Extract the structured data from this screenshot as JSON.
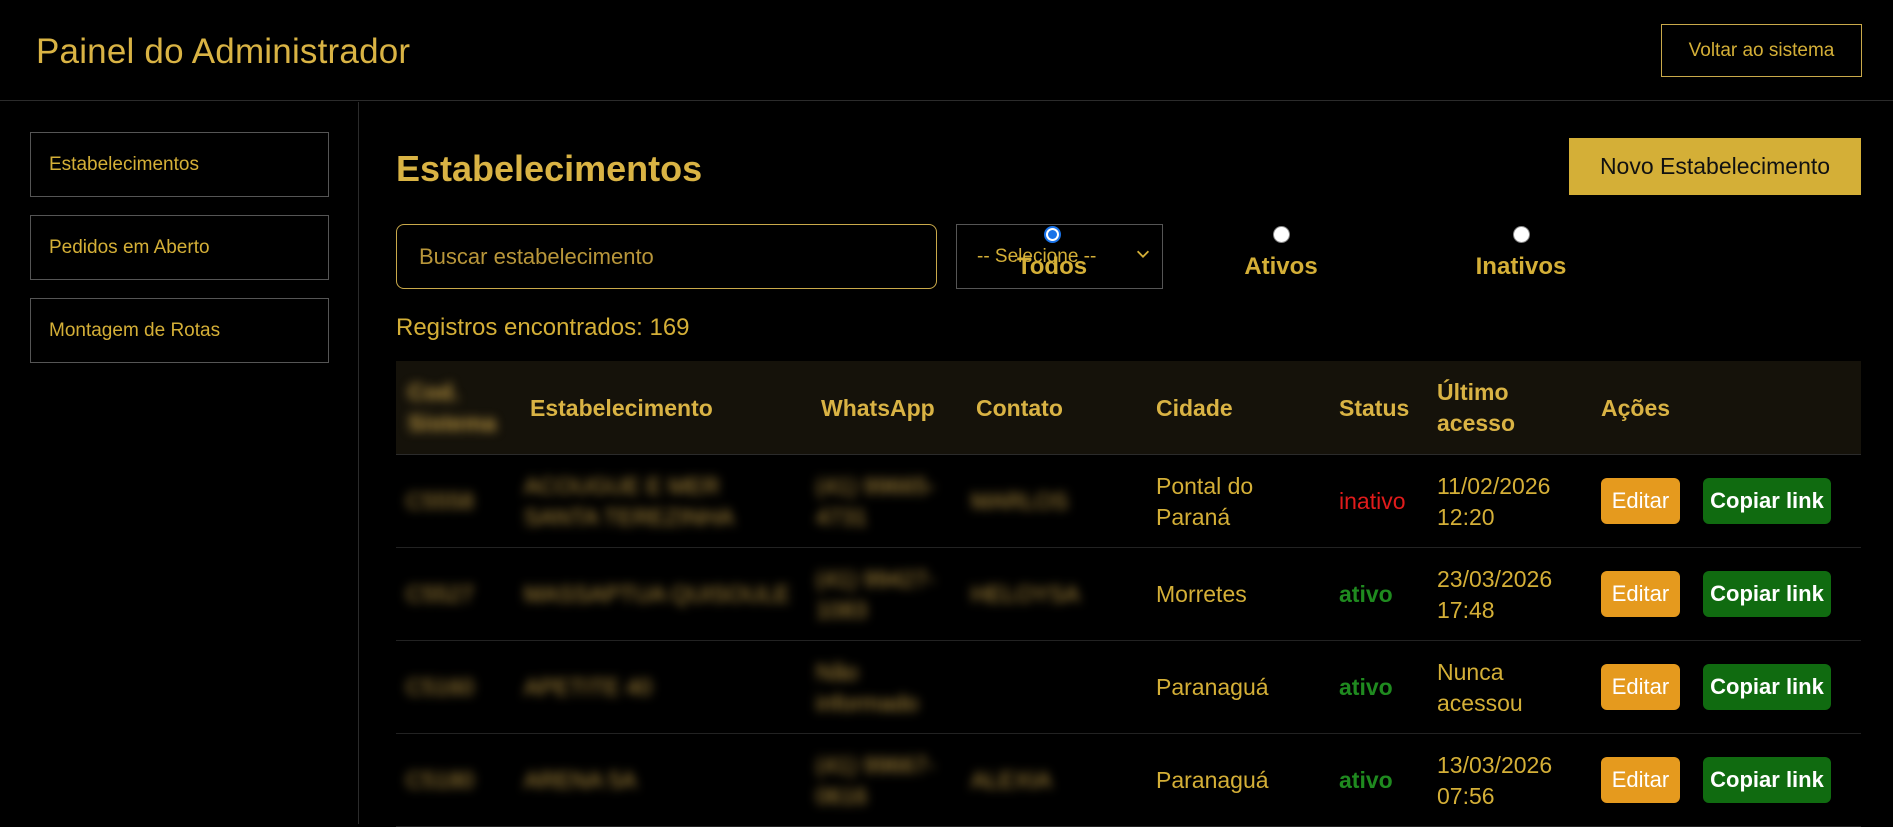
{
  "header": {
    "title": "Painel do Administrador",
    "back_label": "Voltar ao sistema"
  },
  "sidebar": {
    "items": [
      {
        "label": "Estabelecimentos"
      },
      {
        "label": "Pedidos em Aberto"
      },
      {
        "label": "Montagem de Rotas"
      }
    ]
  },
  "main": {
    "title": "Estabelecimentos",
    "new_label": "Novo Estabelecimento",
    "search_placeholder": "Buscar estabelecimento",
    "select_value": "-- Selecione --",
    "radios": [
      {
        "label": "Todos",
        "checked": true
      },
      {
        "label": "Ativos",
        "checked": false
      },
      {
        "label": "Inativos",
        "checked": false
      }
    ],
    "records_text": "Registros encontrados: 169"
  },
  "table": {
    "headers": [
      "Cod. Sistema",
      "Estabelecimento",
      "WhatsApp",
      "Contato",
      "Cidade",
      "Status",
      "Último acesso",
      "Ações"
    ],
    "rows": [
      {
        "code": "C5558",
        "name": "ACOUGUE E MER SANTA TEREZINHA",
        "whatsapp": "(41) 99665-4731",
        "contact": "MARLOS",
        "city": "Pontal do Paraná",
        "status": "inativo",
        "last_access": "11/02/2026 12:20",
        "edit": "Editar",
        "copy": "Copiar link"
      },
      {
        "code": "C5527",
        "name": "MASSAPTUA QUISOULE",
        "whatsapp": "(41) 99427-1083",
        "contact": "HELOYSA",
        "city": "Morretes",
        "status": "ativo",
        "last_access": "23/03/2026 17:48",
        "edit": "Editar",
        "copy": "Copiar link"
      },
      {
        "code": "C5160",
        "name": "APETITE 40",
        "whatsapp": "Não informado",
        "contact": "",
        "city": "Paranaguá",
        "status": "ativo",
        "last_access": "Nunca acessou",
        "edit": "Editar",
        "copy": "Copiar link"
      },
      {
        "code": "C5180",
        "name": "ARENA 5A",
        "whatsapp": "(41) 99667-0616",
        "contact": "ALEXIA",
        "city": "Paranaguá",
        "status": "ativo",
        "last_access": "13/03/2026 07:56",
        "edit": "Editar",
        "copy": "Copiar link"
      }
    ]
  },
  "colors": {
    "gold": "#d4af37",
    "background": "#000000",
    "active": "#1f8a1f",
    "inactive": "#e01b1b",
    "edit_button": "#e59a1e",
    "copy_button": "#106b10"
  }
}
